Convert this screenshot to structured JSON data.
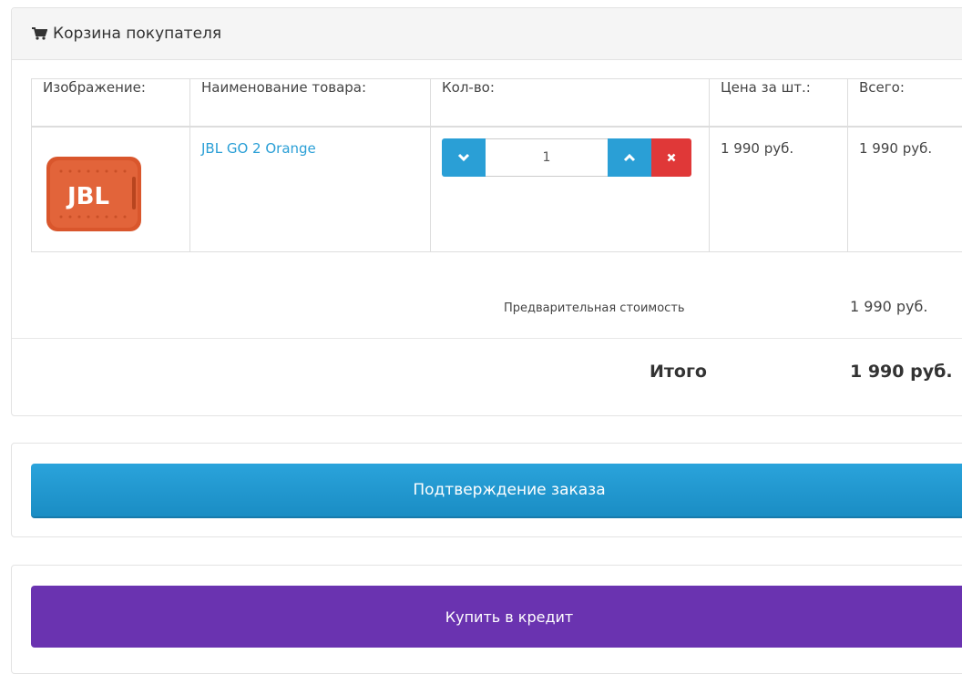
{
  "cart": {
    "title": "Корзина покупателя",
    "columns": [
      "Изображение:",
      "Наименование товара:",
      "Кол-во:",
      "Цена за шт.:",
      "Всего:"
    ],
    "items": [
      {
        "name": "JBL GO 2 Orange",
        "quantity": "1",
        "unit_price": "1 990 руб.",
        "total": "1 990 руб."
      }
    ],
    "subtotal_label": "Предварительная стоимость",
    "subtotal_value": "1 990 руб.",
    "total_label": "Итого",
    "total_value": "1 990 руб."
  },
  "actions": {
    "confirm_label": "Подтверждение заказа",
    "credit_label": "Купить в кредит"
  },
  "colors": {
    "primary": "#2a9fd6",
    "danger": "#e03838",
    "credit": "#6a33b0",
    "product": "#e2643a"
  }
}
